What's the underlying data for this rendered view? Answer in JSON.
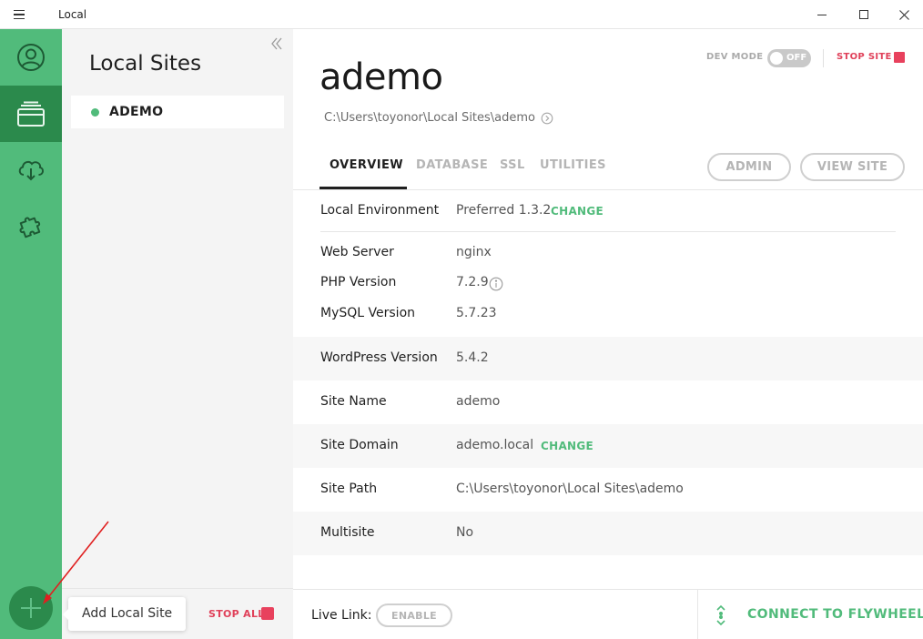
{
  "window": {
    "app_title": "Local"
  },
  "rail": {
    "items": [
      "account",
      "sites",
      "connect",
      "addons"
    ],
    "accent_color": "#51bb7b",
    "active_color": "#2b8a4c"
  },
  "sites_panel": {
    "title": "Local Sites",
    "sites": [
      {
        "name": "ADEMO",
        "status": "running"
      }
    ],
    "tooltip": "Add Local Site",
    "stop_all_label": "STOP ALL"
  },
  "site": {
    "name": "ademo",
    "path": "C:\\Users\\toyonor\\Local Sites\\ademo",
    "dev_mode_label": "DEV MODE",
    "dev_mode_state": "OFF",
    "stop_site_label": "STOP SITE",
    "tabs": [
      "OVERVIEW",
      "DATABASE",
      "SSL",
      "UTILITIES"
    ],
    "active_tab": "OVERVIEW",
    "admin_button": "ADMIN",
    "view_site_button": "VIEW SITE",
    "overview": {
      "local_environment": {
        "label": "Local Environment",
        "value": "Preferred 1.3.2",
        "action": "CHANGE"
      },
      "web_server": {
        "label": "Web Server",
        "value": "nginx"
      },
      "php_version": {
        "label": "PHP Version",
        "value": "7.2.9"
      },
      "mysql_version": {
        "label": "MySQL Version",
        "value": "5.7.23"
      },
      "wordpress_version": {
        "label": "WordPress Version",
        "value": "5.4.2"
      },
      "site_name": {
        "label": "Site Name",
        "value": "ademo"
      },
      "site_domain": {
        "label": "Site Domain",
        "value": "ademo.local",
        "action": "CHANGE"
      },
      "site_path": {
        "label": "Site Path",
        "value": "C:\\Users\\toyonor\\Local Sites\\ademo"
      },
      "multisite": {
        "label": "Multisite",
        "value": "No"
      }
    }
  },
  "bottom_bar": {
    "live_link_label": "Live Link:",
    "enable_label": "ENABLE",
    "flywheel_label": "CONNECT TO FLYWHEEL"
  }
}
